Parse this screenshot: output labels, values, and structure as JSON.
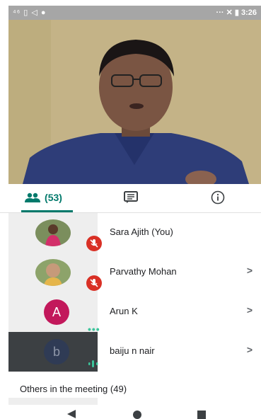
{
  "status": {
    "left_icons": "⁴⁶ ▯ ◁ ●",
    "right_icons": "··· ✕ ▮",
    "time": "3:26"
  },
  "tabs": {
    "people_count": "(53)"
  },
  "participants": [
    {
      "name": "Sara Ajith (You)",
      "avatar": "photo",
      "muted": true,
      "chevron": false
    },
    {
      "name": "Parvathy Mohan",
      "avatar": "photo",
      "muted": true,
      "chevron": true
    },
    {
      "name": "Arun K",
      "avatar_letter": "A",
      "muted": false,
      "chevron": true
    },
    {
      "name": "baiju n nair",
      "avatar_letter": "b",
      "muted": false,
      "chevron": true
    }
  ],
  "others_heading": "Others in the meeting (49)",
  "chevron_glyph": ">",
  "icons": [
    "people-icon",
    "chat-icon",
    "info-icon",
    "mic-off-icon",
    "back-icon",
    "home-icon",
    "recents-icon"
  ],
  "colors": {
    "accent": "#00796b",
    "mute": "#d93025",
    "avatar_a": "#c2185b"
  }
}
